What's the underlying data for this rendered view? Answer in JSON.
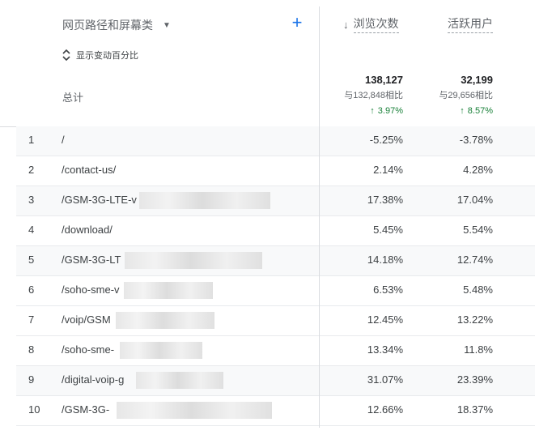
{
  "header": {
    "dimension_label": "网页路径和屏幕类",
    "dimension_dropdown_icon": "caret-down-icon",
    "add_icon": "plus-icon",
    "add_symbol": "+",
    "toggle_icon": "unfold-icon",
    "toggle_label": "显示变动百分比",
    "total_label": "总计"
  },
  "metrics": [
    {
      "label": "浏览次数",
      "sorted": true,
      "sort_icon": "arrow-down-icon",
      "sort_symbol": "↓",
      "total": "138,127",
      "compare": "与132,848相比",
      "change": "3.97%",
      "change_direction": "up",
      "change_symbol": "↑"
    },
    {
      "label": "活跃用户",
      "sorted": false,
      "total": "32,199",
      "compare": "与29,656相比",
      "change": "8.57%",
      "change_direction": "up",
      "change_symbol": "↑"
    }
  ],
  "rows": [
    {
      "index": "1",
      "path": "/",
      "views_change": "-5.25%",
      "users_change": "-3.78%",
      "redacted": false
    },
    {
      "index": "2",
      "path": "/contact-us/",
      "views_change": "2.14%",
      "users_change": "4.28%",
      "redacted": false
    },
    {
      "index": "3",
      "path": "/GSM-3G-LTE-v",
      "views_change": "17.38%",
      "users_change": "17.04%",
      "redacted": true
    },
    {
      "index": "4",
      "path": "/download/",
      "views_change": "5.45%",
      "users_change": "5.54%",
      "redacted": false
    },
    {
      "index": "5",
      "path": "/GSM-3G-LT",
      "views_change": "14.18%",
      "users_change": "12.74%",
      "redacted": true
    },
    {
      "index": "6",
      "path": "/soho-sme-v",
      "views_change": "6.53%",
      "users_change": "5.48%",
      "redacted": true
    },
    {
      "index": "7",
      "path": "/voip/GSM",
      "views_change": "12.45%",
      "users_change": "13.22%",
      "redacted": true
    },
    {
      "index": "8",
      "path": "/soho-sme-",
      "views_change": "13.34%",
      "users_change": "11.8%",
      "redacted": true
    },
    {
      "index": "9",
      "path": "/digital-voip-g",
      "views_change": "31.07%",
      "users_change": "23.39%",
      "redacted": true
    },
    {
      "index": "10",
      "path": "/GSM-3G-",
      "views_change": "12.66%",
      "users_change": "18.37%",
      "redacted": true
    }
  ],
  "colors": {
    "accent": "#1a73e8",
    "positive": "#188038",
    "divider": "#dadce0",
    "row_shade": "#f8f9fa"
  }
}
